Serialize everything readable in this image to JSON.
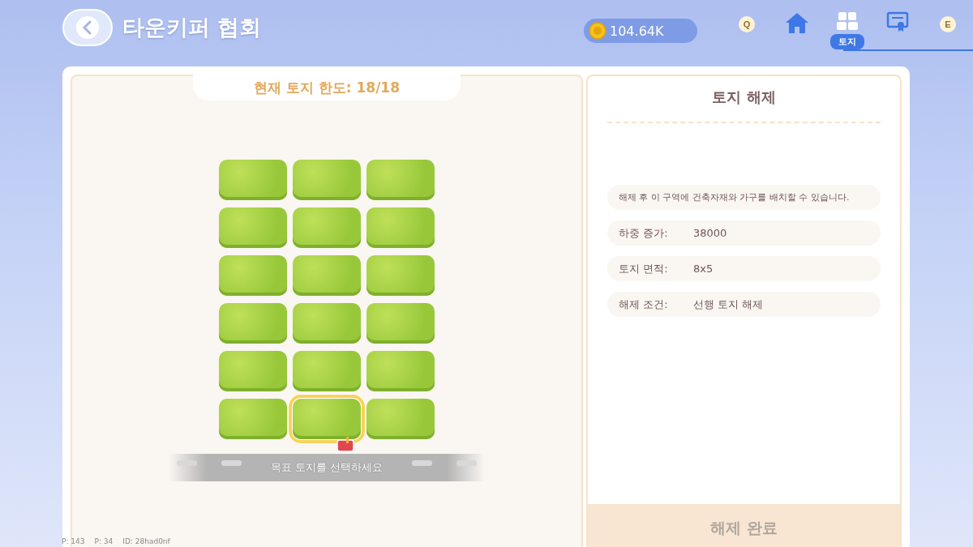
{
  "header": {
    "title": "타운키퍼 협회",
    "coins": "104.64K"
  },
  "nav": [
    {
      "kind": "key",
      "text": "Q",
      "selected": false
    },
    {
      "kind": "home",
      "selected": false
    },
    {
      "kind": "land",
      "label": "토지",
      "selected": true
    },
    {
      "kind": "certificate",
      "selected": false
    },
    {
      "kind": "key",
      "text": "E",
      "selected": false
    }
  ],
  "land_panel": {
    "limit": "현재 토지 한도: 18/18",
    "hint": "목표 토지를 선택하세요",
    "tiles": [
      {
        "selected": false
      },
      {
        "selected": false
      },
      {
        "selected": false
      },
      {
        "selected": false
      },
      {
        "selected": false
      },
      {
        "selected": false
      },
      {
        "selected": false
      },
      {
        "selected": false
      },
      {
        "selected": false
      },
      {
        "selected": false
      },
      {
        "selected": false
      },
      {
        "selected": false
      },
      {
        "selected": false
      },
      {
        "selected": false
      },
      {
        "selected": false
      },
      {
        "selected": false
      },
      {
        "selected": true
      },
      {
        "selected": false
      }
    ]
  },
  "detail": {
    "title": "토지 해제",
    "description": "해제 후 이 구역에 건축자재와 가구를 배치할 수 있습니다.",
    "rows": [
      {
        "label": "하중 증가:",
        "value": "38000"
      },
      {
        "label": "토지 면적:",
        "value": "8x5"
      },
      {
        "label": "해제 조건:",
        "value": "선행 토지 해제"
      }
    ],
    "button": "해제 완료"
  },
  "debug": [
    "P: 143",
    "P: 34",
    "ID: 28had0nf"
  ]
}
